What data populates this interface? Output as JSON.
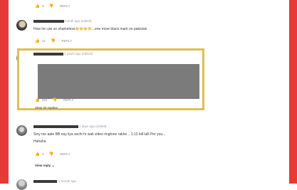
{
  "comments": [
    {
      "meta": "",
      "text": "",
      "likes": "9",
      "reply_label": "REPLY"
    },
    {
      "meta": "month ago (edited)",
      "text": "How he can so shameless",
      "text_emoji": "😂😂😂😂",
      "text_tail": "...one more black mark on pakistan",
      "likes": "21",
      "reply_label": "REPLY"
    },
    {
      "meta": "2 years ago (edited)",
      "likes": "501",
      "reply_label": "REPLY",
      "view_replies": "View 33 replies"
    },
    {
      "meta": "2 days ago (edited)",
      "text": "Siny me aate BB nay liya sochi hr wali video ringtone rakhe... 1:13 bill lulli Per you...",
      "subtext": "Hahaha",
      "likes": "3",
      "reply_label": "REPLY",
      "view_reply": "View reply"
    },
    {
      "meta": "1 month ago"
    }
  ],
  "icons": {
    "like": "thumb-up-icon",
    "dislike": "thumb-down-icon",
    "expand": "chevron-down-icon"
  },
  "colors": {
    "edge": "#e63a36",
    "highlight": "#dcc14e",
    "redaction": "#7b7b7b"
  }
}
